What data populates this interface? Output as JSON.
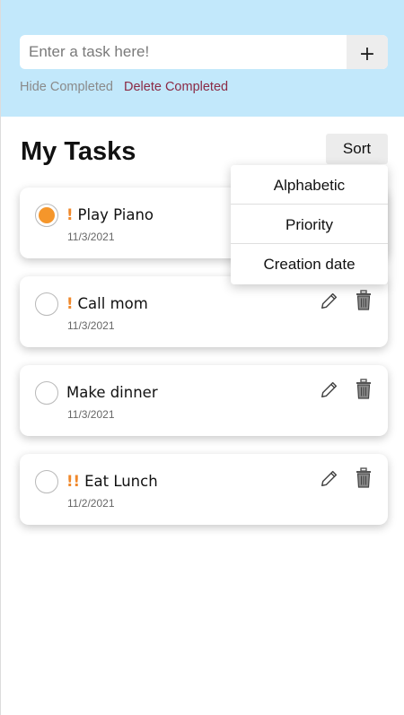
{
  "header": {
    "input_placeholder": "Enter a task here!",
    "add_label": "+",
    "hide_completed": "Hide Completed",
    "delete_completed": "Delete Completed",
    "background": "#c2e8fb"
  },
  "main": {
    "title": "My Tasks",
    "sort_label": "Sort"
  },
  "sort_menu": {
    "options": [
      "Alphabetic",
      "Priority",
      "Creation date"
    ]
  },
  "tasks": [
    {
      "priority": "!",
      "name": "Play Piano",
      "date": "11/3/2021",
      "completed": true
    },
    {
      "priority": "!",
      "name": "Call mom",
      "date": "11/3/2021",
      "completed": false
    },
    {
      "priority": "",
      "name": "Make dinner",
      "date": "11/3/2021",
      "completed": false
    },
    {
      "priority": "!!",
      "name": "Eat Lunch",
      "date": "11/2/2021",
      "completed": false
    }
  ],
  "colors": {
    "accent": "#f5962b",
    "priority": "#f0882a",
    "danger_link": "#8b2a45"
  },
  "icons": {
    "edit": "pencil-icon",
    "delete": "trash-icon",
    "add": "plus-icon"
  }
}
